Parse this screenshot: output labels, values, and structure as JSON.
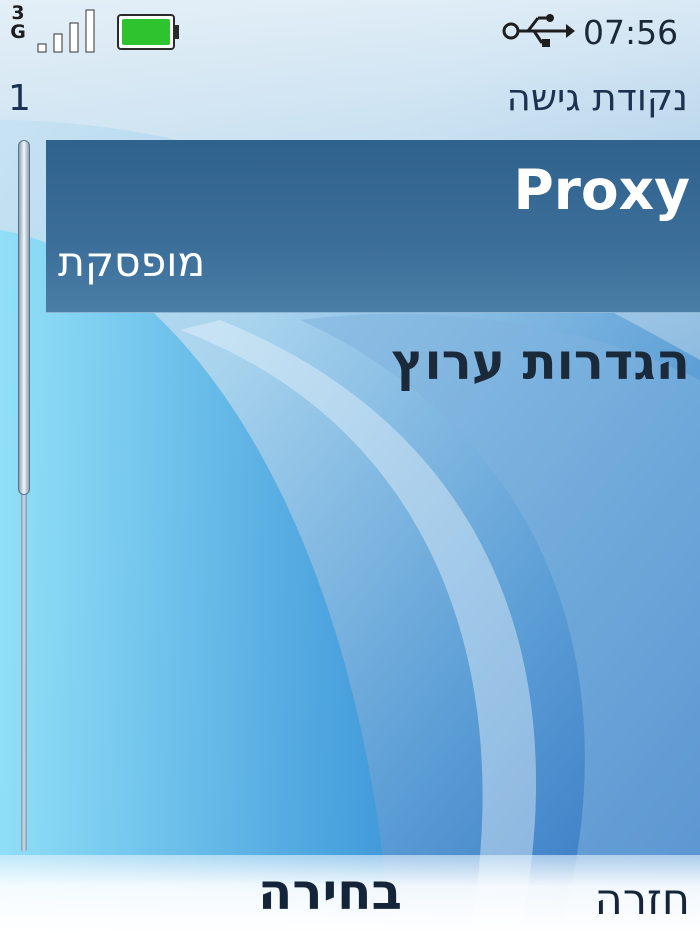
{
  "status": {
    "network_type_line1": "3",
    "network_type_line2": "G",
    "signal_bars": 4,
    "battery_level_percent": 100,
    "usb_connected": true,
    "time": "07:56"
  },
  "header": {
    "title": "נקודת גישה",
    "page_index": "1"
  },
  "list": {
    "items": [
      {
        "label": "Proxy",
        "value": "מופסקת",
        "selected": true
      },
      {
        "label": "הגדרות ערוץ",
        "selected": false
      }
    ]
  },
  "softkeys": {
    "center": "בחירה",
    "right": "חזרה"
  },
  "colors": {
    "highlight": "#3a6d98",
    "battery": "#2fc32f",
    "text_dark": "#1b3350"
  },
  "icons": {
    "signal": "signal-strength-icon",
    "battery": "battery-icon",
    "usb": "usb-icon"
  }
}
